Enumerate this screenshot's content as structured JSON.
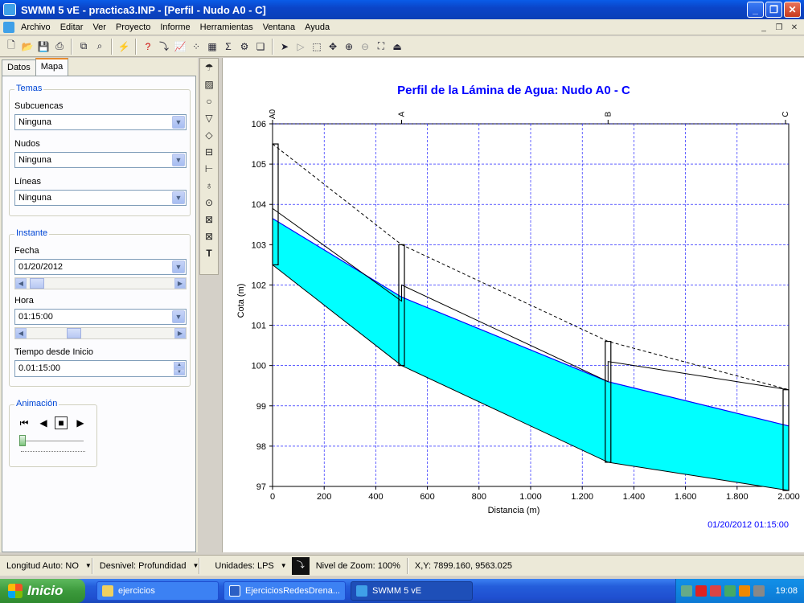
{
  "window": {
    "title": "SWMM 5 vE - practica3.INP - [Perfil - Nudo A0 - C]"
  },
  "menu": [
    "Archivo",
    "Editar",
    "Ver",
    "Proyecto",
    "Informe",
    "Herramientas",
    "Ventana",
    "Ayuda"
  ],
  "left": {
    "tabs": [
      "Datos",
      "Mapa"
    ],
    "temas": {
      "title": "Temas",
      "subcuencas_label": "Subcuencas",
      "subcuencas_value": "Ninguna",
      "nudos_label": "Nudos",
      "nudos_value": "Ninguna",
      "lineas_label": "Líneas",
      "lineas_value": "Ninguna"
    },
    "instante": {
      "title": "Instante",
      "fecha_label": "Fecha",
      "fecha_value": "01/20/2012",
      "hora_label": "Hora",
      "hora_value": "01:15:00",
      "tiempo_label": "Tiempo desde Inicio",
      "tiempo_value": "0.01:15:00"
    },
    "animacion": {
      "title": "Animación"
    }
  },
  "chart_data": {
    "type": "line",
    "title": "Perfil de la Lámina de Agua:  Nudo A0 - C",
    "xlabel": "Distancia (m)",
    "ylabel": "Cota (m)",
    "xlim": [
      0,
      2000
    ],
    "ylim": [
      97,
      106
    ],
    "x_ticks": [
      "0",
      "200",
      "400",
      "600",
      "800",
      "1.000",
      "1.200",
      "1.400",
      "1.600",
      "1.800",
      "2.000"
    ],
    "y_ticks": [
      "97",
      "98",
      "99",
      "100",
      "101",
      "102",
      "103",
      "104",
      "105",
      "106"
    ],
    "grid": true,
    "nodes": [
      {
        "name": "A0",
        "x": 0,
        "invert": 102.5,
        "top": 105.5
      },
      {
        "name": "A",
        "x": 500,
        "invert": 100.0,
        "top": 103.0
      },
      {
        "name": "B",
        "x": 1300,
        "invert": 97.6,
        "top": 100.6
      },
      {
        "name": "C",
        "x": 2000,
        "invert": 96.9,
        "top": 99.4
      }
    ],
    "conduit_bottom": {
      "x": [
        0,
        500,
        500,
        1300,
        1300,
        2000
      ],
      "y": [
        102.5,
        100.0,
        100.0,
        97.6,
        97.6,
        96.9
      ]
    },
    "conduit_top": {
      "x": [
        0,
        500,
        500,
        1300,
        1300,
        2000
      ],
      "y": [
        103.9,
        101.6,
        102.0,
        99.6,
        100.1,
        99.4
      ]
    },
    "water_surface": {
      "x": [
        0,
        500,
        1300,
        2000
      ],
      "y": [
        103.65,
        101.7,
        99.6,
        98.5
      ]
    },
    "ground_line": {
      "x": [
        0,
        500,
        1300,
        2000
      ],
      "y": [
        105.5,
        103.0,
        100.6,
        99.4
      ]
    },
    "timestamp": "01/20/2012 01:15:00",
    "colors": {
      "water": "#00ffff",
      "surface": "#0000ff",
      "title": "#0000ff"
    }
  },
  "status": {
    "longitud": "Longitud Auto: NO",
    "desnivel": "Desnivel: Profundidad",
    "unidades": "Unidades: LPS",
    "zoom": "Nivel de Zoom: 100%",
    "xy": "X,Y: 7899.160, 9563.025"
  },
  "taskbar": {
    "start": "Inicio",
    "tasks": [
      "ejercicios",
      "EjerciciosRedesDrena...",
      "SWMM 5 vE"
    ],
    "clock": "19:08"
  }
}
